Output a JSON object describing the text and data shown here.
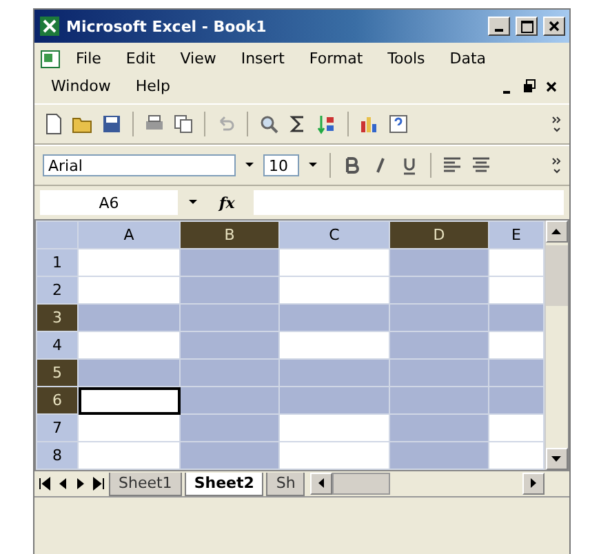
{
  "window": {
    "title": "Microsoft Excel - Book1"
  },
  "menu": [
    "File",
    "Edit",
    "View",
    "Insert",
    "Format",
    "Tools",
    "Data",
    "Window",
    "Help"
  ],
  "format_toolbar": {
    "font": "Arial",
    "size": "10"
  },
  "formula_bar": {
    "name_box": "A6",
    "fx": "fx"
  },
  "grid": {
    "columns": [
      {
        "label": "A",
        "selected": false
      },
      {
        "label": "B",
        "selected": true
      },
      {
        "label": "C",
        "selected": false
      },
      {
        "label": "D",
        "selected": true
      },
      {
        "label": "E",
        "selected": false
      }
    ],
    "rows": [
      {
        "label": "1",
        "selected": false,
        "cells": [
          {
            "active": false
          },
          {
            "active": false
          },
          {
            "active": false
          },
          {
            "active": false
          },
          {
            "active": false
          }
        ]
      },
      {
        "label": "2",
        "selected": false,
        "cells": [
          {
            "active": false
          },
          {
            "active": false
          },
          {
            "active": false
          },
          {
            "active": false
          },
          {
            "active": false
          }
        ]
      },
      {
        "label": "3",
        "selected": true,
        "cells": [
          {
            "active": false
          },
          {
            "active": false
          },
          {
            "active": false
          },
          {
            "active": false
          },
          {
            "active": false
          }
        ]
      },
      {
        "label": "4",
        "selected": false,
        "cells": [
          {
            "active": false
          },
          {
            "active": false
          },
          {
            "active": false
          },
          {
            "active": false
          },
          {
            "active": false
          }
        ]
      },
      {
        "label": "5",
        "selected": true,
        "cells": [
          {
            "active": false
          },
          {
            "active": false
          },
          {
            "active": false
          },
          {
            "active": false
          },
          {
            "active": false
          }
        ]
      },
      {
        "label": "6",
        "selected": true,
        "cells": [
          {
            "active": true
          },
          {
            "active": false
          },
          {
            "active": false
          },
          {
            "active": false
          },
          {
            "active": false
          }
        ]
      },
      {
        "label": "7",
        "selected": false,
        "cells": [
          {
            "active": false
          },
          {
            "active": false
          },
          {
            "active": false
          },
          {
            "active": false
          },
          {
            "active": false
          }
        ]
      },
      {
        "label": "8",
        "selected": false,
        "cells": [
          {
            "active": false
          },
          {
            "active": false
          },
          {
            "active": false
          },
          {
            "active": false
          },
          {
            "active": false
          }
        ]
      }
    ]
  },
  "sheet_tabs": [
    {
      "label": "Sheet1",
      "selected": false
    },
    {
      "label": "Sheet2",
      "selected": true
    },
    {
      "label": "Sh",
      "selected": false
    }
  ]
}
